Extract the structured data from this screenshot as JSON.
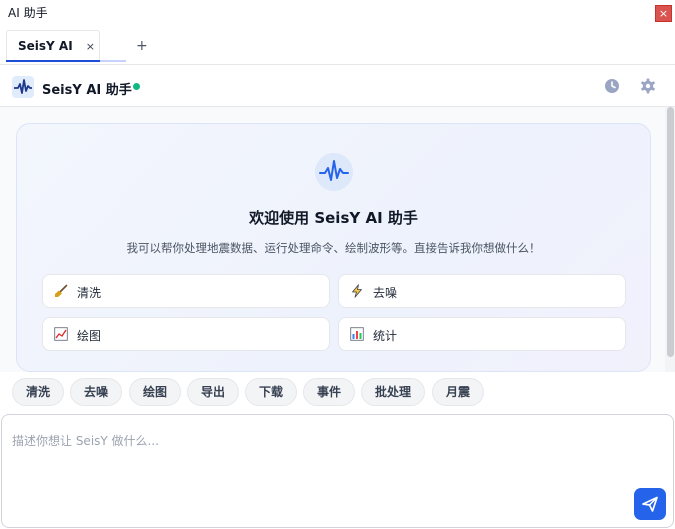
{
  "window": {
    "title": "AI 助手",
    "close_label": "×"
  },
  "tabs": [
    {
      "label": "SeisY AI",
      "close": "×"
    }
  ],
  "tab_add_label": "+",
  "header": {
    "app_name": "SeisY AI 助手",
    "status_color": "#10b981"
  },
  "welcome": {
    "title": "欢迎使用 SeisY AI 助手",
    "subtitle": "我可以帮你处理地震数据、运行处理命令、绘制波形等。直接告诉我你想做什么！",
    "quick_actions": [
      {
        "label": "清洗",
        "icon": "broom-icon"
      },
      {
        "label": "去噪",
        "icon": "lightning-icon"
      },
      {
        "label": "绘图",
        "icon": "chart-line-icon"
      },
      {
        "label": "统计",
        "icon": "bar-chart-icon"
      }
    ]
  },
  "chips": [
    "清洗",
    "去噪",
    "绘图",
    "导出",
    "下载",
    "事件",
    "批处理",
    "月震"
  ],
  "input": {
    "placeholder": "描述你想让 SeisY 做什么...",
    "value": ""
  },
  "colors": {
    "accent": "#2563eb",
    "brand": "#1d4ed8",
    "status": "#10b981"
  },
  "icons": {
    "logo": "waveform-logo-icon",
    "history": "clock-icon",
    "settings": "gear-icon",
    "send": "send-icon"
  }
}
